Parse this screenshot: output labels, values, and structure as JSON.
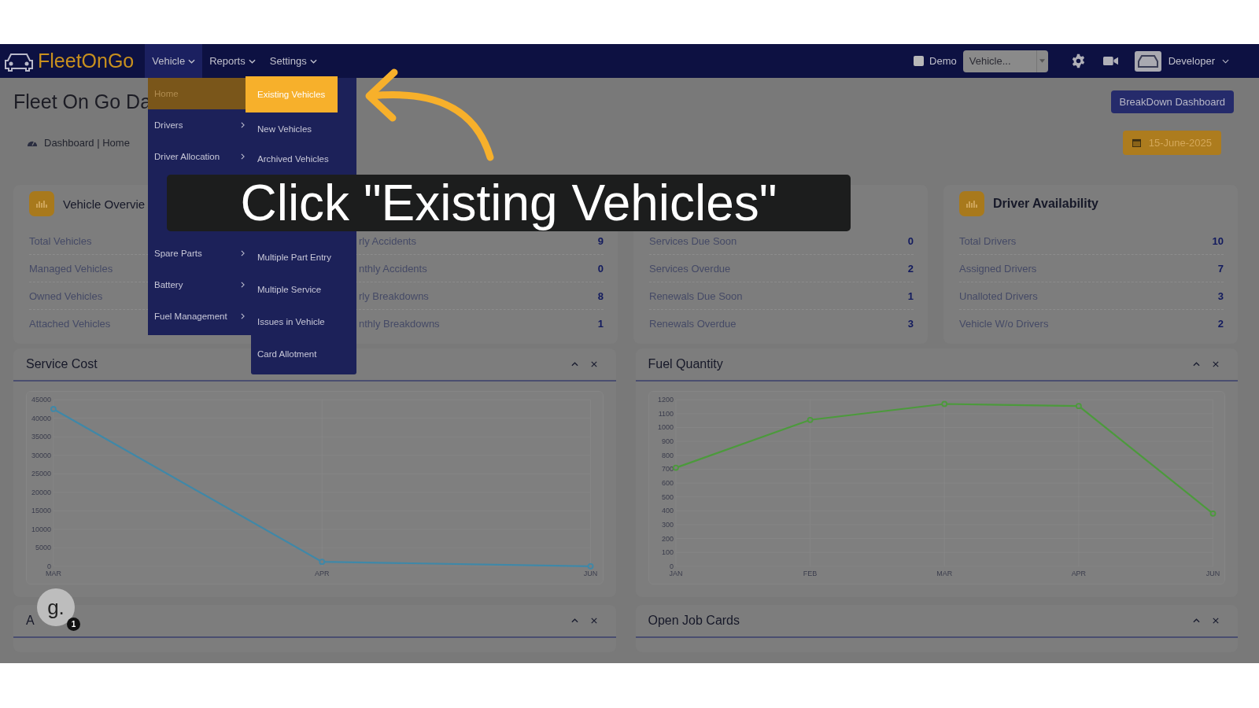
{
  "nav": {
    "logo": "FleetOnGo",
    "items": [
      {
        "label": "Vehicle",
        "selected": true
      },
      {
        "label": "Reports",
        "selected": false
      },
      {
        "label": "Settings",
        "selected": false
      }
    ],
    "demo": {
      "label": "Demo",
      "checked": false
    },
    "vehicle_select": {
      "value": "Vehicle..."
    },
    "user": "Developer"
  },
  "menu": {
    "column_1": [
      {
        "label": "Home",
        "selected": true,
        "has_submenu": false
      },
      {
        "label": "Drivers",
        "selected": false,
        "has_submenu": true
      },
      {
        "label": "Driver Allocation",
        "selected": false,
        "has_submenu": true
      },
      {
        "label": "Spare Parts",
        "selected": false,
        "has_submenu": true
      },
      {
        "label": "Battery",
        "selected": false,
        "has_submenu": true
      },
      {
        "label": "Fuel Management",
        "selected": false,
        "has_submenu": true
      }
    ],
    "column_2": [
      {
        "label": "Existing Vehicles",
        "selected": true
      },
      {
        "label": "New Vehicles",
        "selected": false
      },
      {
        "label": "Archived Vehicles",
        "selected": false
      },
      {
        "label": "Multiple Part Entry",
        "selected": false
      },
      {
        "label": "Multiple Service",
        "selected": false
      },
      {
        "label": "Issues in Vehicle",
        "selected": false
      },
      {
        "label": "Card Allotment",
        "selected": false
      }
    ]
  },
  "page": {
    "title": "Fleet On Go Da",
    "breadcrumb": "Dashboard | Home",
    "breakdown_button": "BreakDown Dashboard",
    "date": "15-June-2025"
  },
  "cards": [
    {
      "title": "Vehicle Overvie",
      "rows": [
        {
          "label": "Total Vehicles"
        },
        {
          "label": "Managed Vehicles"
        },
        {
          "label": "Owned Vehicles"
        },
        {
          "label": "Attached Vehicles"
        }
      ]
    },
    {
      "rows": [
        {
          "label": "rly Accidents",
          "value": "9"
        },
        {
          "label": "nthly Accidents",
          "value": "0"
        },
        {
          "label": "rly Breakdowns",
          "value": "8"
        },
        {
          "label": "nthly Breakdowns",
          "value": "1"
        }
      ]
    },
    {
      "rows": [
        {
          "label": "Services Due Soon",
          "value": "0"
        },
        {
          "label": "Services Overdue",
          "value": "2"
        },
        {
          "label": "Renewals Due Soon",
          "value": "1"
        },
        {
          "label": "Renewals Overdue",
          "value": "3"
        }
      ]
    },
    {
      "title": "Driver Availability",
      "rows": [
        {
          "label": "Total Drivers",
          "value": "10"
        },
        {
          "label": "Assigned Drivers",
          "value": "7"
        },
        {
          "label": "Unalloted Drivers",
          "value": "3"
        },
        {
          "label": "Vehicle W/o Drivers",
          "value": "2"
        }
      ]
    }
  ],
  "caption": "Click \"Existing Vehicles\"",
  "panels": [
    {
      "title": "Service Cost",
      "chart_data": {
        "type": "line",
        "grid": true,
        "categories": [
          "MAR",
          "APR",
          "JUN"
        ],
        "series": [
          {
            "color": "#3f88a8",
            "marker": "circle",
            "values": [
              42500,
              1200,
              0
            ]
          }
        ],
        "ylim": [
          0,
          45000
        ],
        "yticks": [
          0,
          5000,
          10000,
          15000,
          20000,
          25000,
          30000,
          35000,
          40000,
          45000
        ]
      }
    },
    {
      "title": "Fuel Quantity",
      "chart_data": {
        "type": "line",
        "grid": true,
        "categories": [
          "JAN",
          "FEB",
          "MAR",
          "APR",
          "JUN"
        ],
        "series": [
          {
            "color": "#4c9a3c",
            "marker": "circle",
            "values": [
              710,
              1055,
              1170,
              1155,
              380
            ]
          }
        ],
        "ylim": [
          0,
          1200
        ],
        "yticks": [
          0,
          100,
          200,
          300,
          400,
          500,
          600,
          700,
          800,
          900,
          1000,
          1100,
          1200
        ]
      }
    },
    {
      "title": "A"
    },
    {
      "title": "Open Job Cards"
    }
  ],
  "helper_widget": {
    "label": "g.",
    "badge": "1"
  }
}
